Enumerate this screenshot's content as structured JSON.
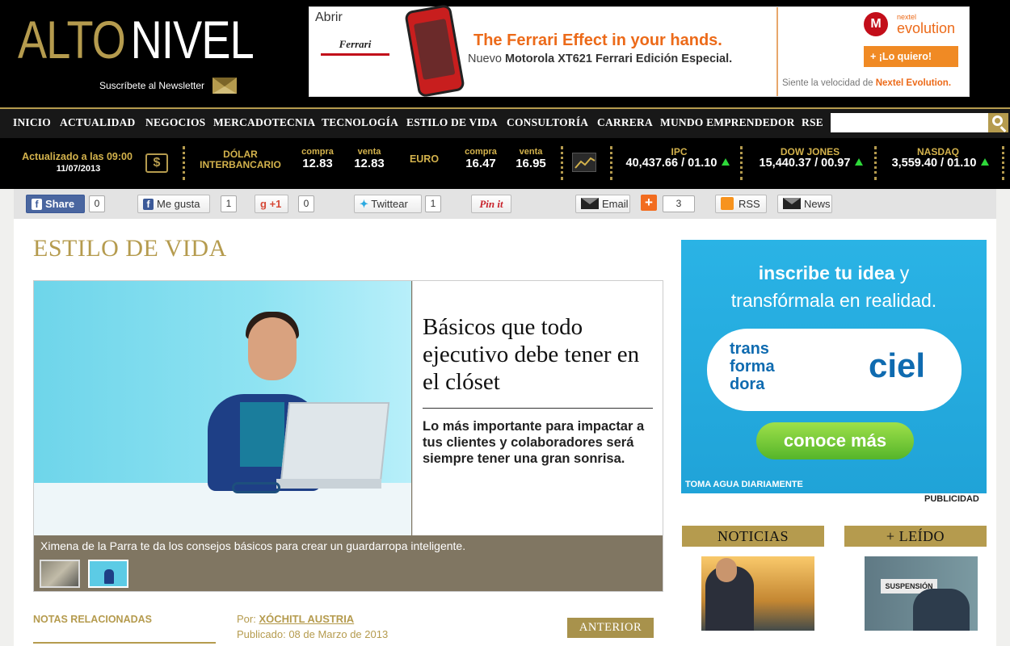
{
  "header": {
    "logo_part1": "ALTO",
    "logo_part2": "NIVEL",
    "newsletter": "Suscríbete al Newsletter"
  },
  "top_ad": {
    "abrir": "Abrir",
    "ferrari": "Ferrari",
    "headline": "The Ferrari Effect in your hands.",
    "sub_prefix": "Nuevo ",
    "sub_bold": "Motorola XT621 Ferrari Edición Especial.",
    "brand_small": "nextel",
    "brand_big": "evolution",
    "cta": "+ ¡Lo quiero!",
    "tagline_prefix": "Siente la velocidad de ",
    "tagline_bold": "Nextel Evolution."
  },
  "nav": {
    "items": [
      "INICIO",
      "ACTUALIDAD",
      "NEGOCIOS",
      "MERCADOTECNIA",
      "TECNOLOGÍA",
      "ESTILO DE VIDA",
      "CONSULTORÍA",
      "CARRERA",
      "MUNDO EMPRENDEDOR",
      "RSE"
    ],
    "search_placeholder": ""
  },
  "ticker": {
    "updated_label": "Actualizado a las 09:00",
    "updated_date": "11/07/2013",
    "dolar_label1": "DÓLAR",
    "dolar_label2": "INTERBANCARIO",
    "compra_label": "compra",
    "venta_label": "venta",
    "dolar_compra": "12.83",
    "dolar_venta": "12.83",
    "euro_label": "EURO",
    "euro_compra": "16.47",
    "euro_venta": "16.95",
    "ipc_label": "IPC",
    "ipc_value": "40,437.66 / 01.10",
    "dow_label": "DOW JONES",
    "dow_value": "15,440.37 / 00.97",
    "nasdaq_label": "NASDAQ",
    "nasdaq_value": "3,559.40 / 01.10",
    "accent": "#d3b24c"
  },
  "social": {
    "share": "Share",
    "share_count": "0",
    "like": "Me gusta",
    "like_count": "1",
    "gplus": "+1",
    "gplus_count": "0",
    "tweet": "Twittear",
    "tweet_count": "1",
    "pinit": "Pin it",
    "email": "Email",
    "addthis_count": "3",
    "rss": "RSS",
    "news": "News"
  },
  "main": {
    "section_title": "ESTILO DE VIDA",
    "headline": "Básicos que todo ejecutivo debe tener en el clóset",
    "deck": "Lo más importante para impactar a tus clientes y colaboradores será siempre tener una gran sonrisa.",
    "caption": "Ximena de la Parra te da los consejos básicos para crear un guardarropa inteligente.",
    "related_title": "NOTAS RELACIONADAS",
    "byline_prefix": "Por: ",
    "author": "XÓCHITL AUSTRIA",
    "published": "Publicado: 08 de Marzo de 2013",
    "prev_button": "ANTERIOR"
  },
  "side_ad": {
    "line1_bold": "inscribe tu idea",
    "line1_rest": " y",
    "line2": "transfórmala en realidad.",
    "bubble_left": "trans forma dora",
    "bubble_right": "ciel",
    "cta": "conoce más",
    "footer": "TOMA AGUA DIARIAMENTE",
    "label": "PUBLICIDAD"
  },
  "sidebar": {
    "tab1": "NOTICIAS",
    "tab2": "+ LEÍDO"
  },
  "colors": {
    "gold": "#b59b4e",
    "nav_bg": "#181818"
  }
}
